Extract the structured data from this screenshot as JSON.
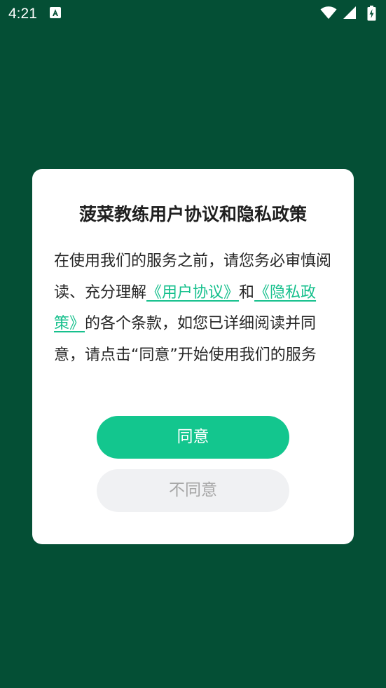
{
  "status_bar": {
    "time": "4:21"
  },
  "dialog": {
    "title": "菠菜教练用户协议和隐私政策",
    "body_part1": "在使用我们的服务之前，请您务必审慎阅读、充分理解",
    "link_user_agreement": "《用户协议》",
    "body_part2": "和",
    "link_privacy_policy": "《隐私政策》",
    "body_part3": "的各个条款，如您已详细阅读并同意，请点击“同意”开始使用我们的服务",
    "agree_label": "同意",
    "disagree_label": "不同意"
  },
  "colors": {
    "background": "#044f35",
    "accent": "#13c68e",
    "link": "#17c08d",
    "disagree_bg": "#f0f1f3"
  },
  "icons": [
    "notification-icon",
    "wifi-icon",
    "signal-icon",
    "battery-icon"
  ]
}
